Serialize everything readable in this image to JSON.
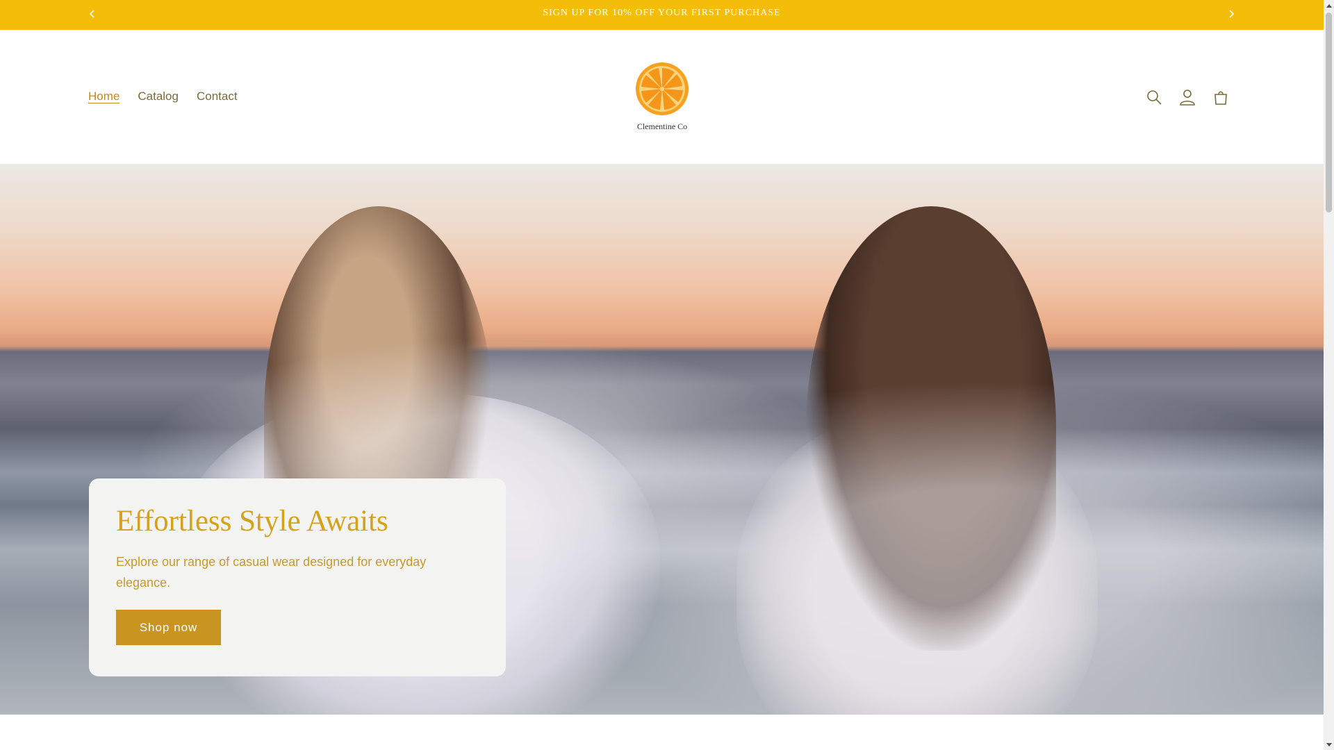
{
  "announcement": {
    "text": "SIGN UP FOR 10% OFF YOUR FIRST PURCHASE",
    "prev_icon": "chevron-left-icon",
    "next_icon": "chevron-right-icon"
  },
  "nav": {
    "items": [
      {
        "label": "Home",
        "active": true
      },
      {
        "label": "Catalog",
        "active": false
      },
      {
        "label": "Contact",
        "active": false
      }
    ]
  },
  "logo": {
    "text": "Clementine Co",
    "icon": "orange-slice-icon"
  },
  "header_icons": [
    "search-icon",
    "account-icon",
    "cart-icon"
  ],
  "hero": {
    "title": "Effortless Style Awaits",
    "subtitle": "Explore our range of casual wear designed for everyday elegance.",
    "button_label": "Shop now"
  },
  "colors": {
    "announcement_bg": "#f3bd0a",
    "accent": "#d4a21b",
    "button": "#c9941f",
    "card_bg": "#f3f4f1"
  }
}
